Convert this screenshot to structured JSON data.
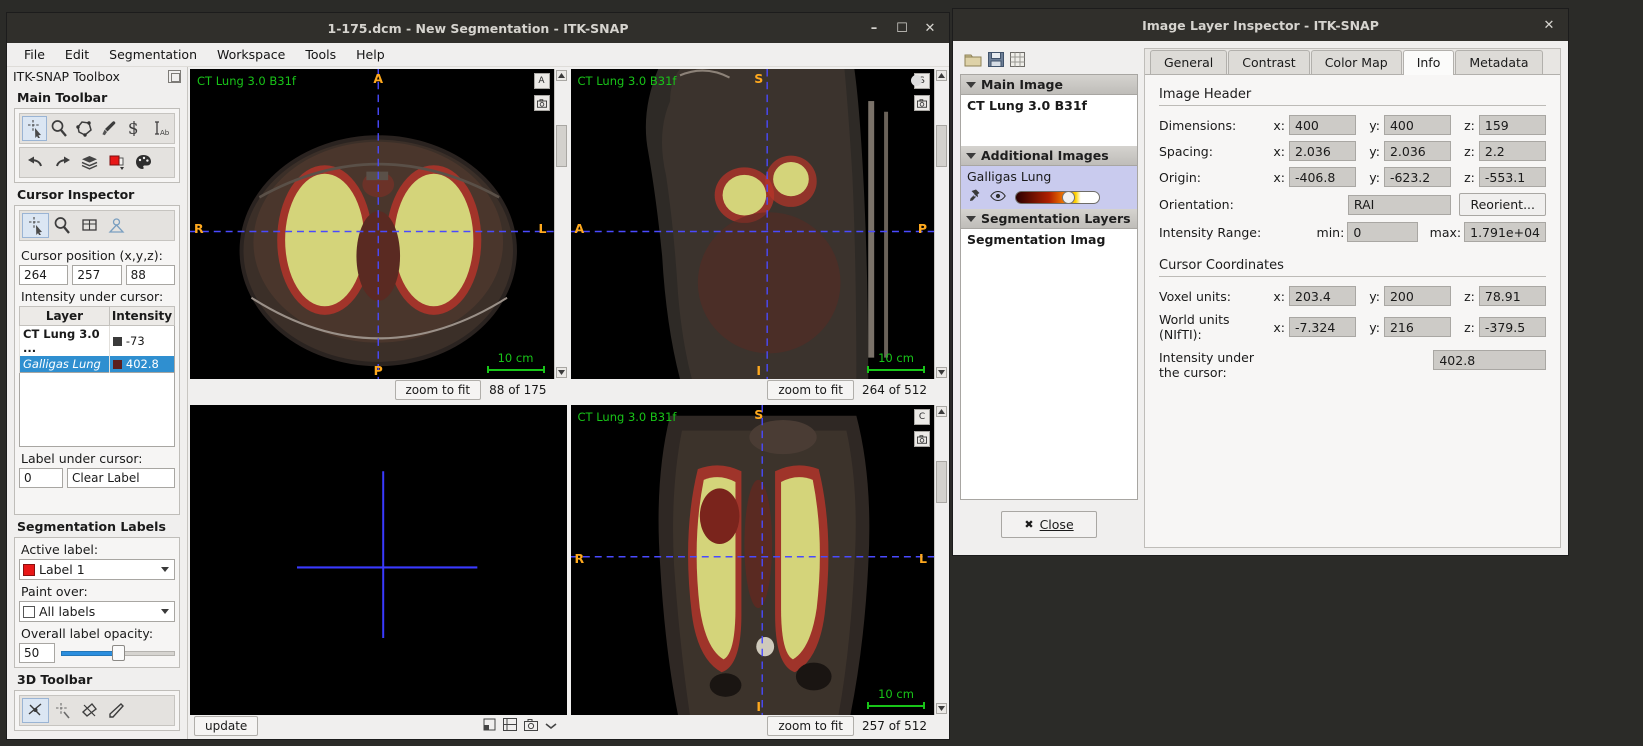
{
  "main_window": {
    "title": "1-175.dcm - New Segmentation - ITK-SNAP",
    "window_buttons": {
      "minimize": "–",
      "maximize": "☐",
      "close": "✕"
    },
    "menus": [
      "File",
      "Edit",
      "Segmentation",
      "Workspace",
      "Tools",
      "Help"
    ]
  },
  "toolbox": {
    "header": "ITK-SNAP Toolbox",
    "main_toolbar_title": "Main Toolbar",
    "main_tools": [
      "crosshair-tool",
      "zoom-pan-tool",
      "polygon-tool",
      "paintbrush-tool",
      "snake-tool",
      "annotation-tool"
    ],
    "edit_tools": [
      "undo-tool",
      "redo-tool",
      "layers-tool",
      "label-color-tool",
      "palette-tool"
    ],
    "cursor_inspector_title": "Cursor Inspector",
    "inspector_tools": [
      "crosshair-tool",
      "zoom-tool",
      "grid-tool",
      "mesh-tool"
    ],
    "cursor_position_label": "Cursor position (x,y,z):",
    "cursor_position": {
      "x": "264",
      "y": "257",
      "z": "88"
    },
    "intensity_label": "Intensity under cursor:",
    "intensity_table": {
      "headers": [
        "Layer",
        "Intensity"
      ],
      "rows": [
        {
          "layer": "CT Lung  3.0 ...",
          "intensity": "-73",
          "color": "#3a3a3a",
          "selected": false
        },
        {
          "layer": "Galligas Lung",
          "intensity": "402.8",
          "color": "#5c1f1f",
          "selected": true
        }
      ]
    },
    "label_under_cursor_label": "Label under cursor:",
    "label_under_cursor_id": "0",
    "label_under_cursor_name": "Clear Label",
    "segmentation_labels_title": "Segmentation Labels",
    "active_label_label": "Active label:",
    "active_label_value": "Label 1",
    "active_label_color": "#e81717",
    "paint_over_label": "Paint over:",
    "paint_over_value": "All labels",
    "opacity_label": "Overall label opacity:",
    "opacity_value": "50",
    "opacity_percent": 50,
    "toolbar3d_title": "3D Toolbar",
    "tools3d": [
      "crosshair-3d-tool",
      "spray-3d-tool",
      "scalpel-3d-tool",
      "cut-3d-tool"
    ]
  },
  "views": {
    "axial": {
      "overlay_label": "CT Lung  3.0  B31f",
      "markers": {
        "top": "A",
        "bottom": "P",
        "left": "R",
        "right": "L"
      },
      "scale_text": "10 cm",
      "zoom_button": "zoom to fit",
      "slice_text": "88 of 175"
    },
    "sagittal": {
      "overlay_label": "CT Lung  3.0  B31f",
      "markers": {
        "top": "S",
        "bottom": "I",
        "left": "A",
        "right": "P"
      },
      "scale_text": "10 cm",
      "zoom_button": "zoom to fit",
      "slice_text": "264 of 512"
    },
    "render3d": {
      "update_button": "update",
      "tools": [
        "reset-view-icon",
        "expand-icon",
        "camera-icon",
        "more-icon"
      ]
    },
    "coronal": {
      "overlay_label": "CT Lung  3.0  B31f",
      "markers": {
        "top": "S",
        "bottom": "I",
        "left": "R",
        "right": "L"
      },
      "scale_text": "10 cm",
      "zoom_button": "zoom to fit",
      "slice_text": "257 of 512"
    }
  },
  "dialog": {
    "title": "Image Layer Inspector - ITK-SNAP",
    "close_x": "✕",
    "toolbar_icons": [
      "open-folder-icon",
      "save-icon",
      "table-icon"
    ],
    "layer_groups": [
      {
        "name": "Main Image",
        "items": [
          {
            "label": "CT Lung  3.0  B31f",
            "bold": true,
            "selected": false
          }
        ]
      },
      {
        "name": "Additional Images",
        "items": [
          {
            "label": "Galligas Lung",
            "bold": false,
            "selected": true
          }
        ]
      },
      {
        "name": "Segmentation Layers",
        "items": [
          {
            "label": "Segmentation Imag",
            "bold": true,
            "selected": false
          }
        ]
      }
    ],
    "tabs": [
      {
        "label": "General",
        "active": false
      },
      {
        "label": "Contrast",
        "active": false
      },
      {
        "label": "Color Map",
        "active": false
      },
      {
        "label": "Info",
        "active": true
      },
      {
        "label": "Metadata",
        "active": false
      }
    ],
    "info": {
      "image_header_title": "Image Header",
      "dimensions_label": "Dimensions:",
      "dimensions": {
        "x": "400",
        "y": "400",
        "z": "159"
      },
      "spacing_label": "Spacing:",
      "spacing": {
        "x": "2.036",
        "y": "2.036",
        "z": "2.2"
      },
      "origin_label": "Origin:",
      "origin": {
        "x": "-406.8",
        "y": "-623.2",
        "z": "-553.1"
      },
      "orientation_label": "Orientation:",
      "orientation_value": "RAI",
      "reorient_button": "Reorient...",
      "intensity_range_label": "Intensity Range:",
      "intensity_min_label": "min:",
      "intensity_min": "0",
      "intensity_max_label": "max:",
      "intensity_max": "1.791e+04",
      "cursor_coordinates_title": "Cursor Coordinates",
      "voxel_units_label": "Voxel units:",
      "voxel_units": {
        "x": "203.4",
        "y": "200",
        "z": "78.91"
      },
      "world_units_label": "World units (NIfTI):",
      "world_units": {
        "x": "-7.324",
        "y": "216",
        "z": "-379.5"
      },
      "intensity_under_label_line1": "Intensity under",
      "intensity_under_label_line2": "the cursor:",
      "intensity_under_value": "402.8",
      "axis_x": "x:",
      "axis_y": "y:",
      "axis_z": "z:"
    },
    "close_button": "Close",
    "close_icon": "✖"
  }
}
